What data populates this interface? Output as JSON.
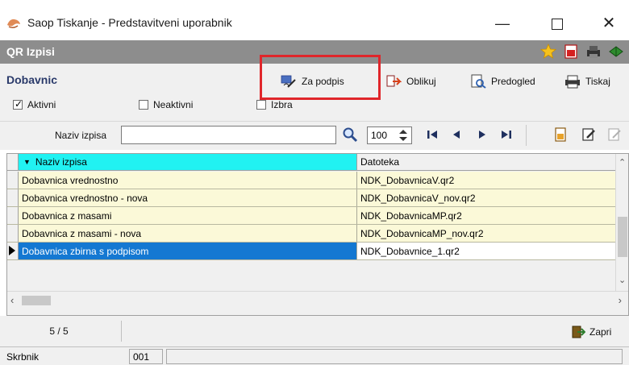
{
  "window": {
    "title": "Saop Tiskanje - Predstavitveni uporabnik",
    "minimize": "—",
    "close": "✕"
  },
  "qrbar": {
    "title": "QR Izpisi"
  },
  "toolbar": {
    "section_title": "Dobavnic",
    "za_podpis": "Za podpis",
    "oblikuj": "Oblikuj",
    "predogled": "Predogled",
    "tiskaj": "Tiskaj"
  },
  "filters": {
    "aktivni": {
      "label": "Aktivni",
      "checked": true
    },
    "neaktivni": {
      "label": "Neaktivni",
      "checked": false
    },
    "izbrani": {
      "label": "Izbra",
      "checked": false
    }
  },
  "search": {
    "label": "Naziv izpisa",
    "value": "",
    "count": "100"
  },
  "grid": {
    "columns": [
      "Naziv izpisa",
      "Datoteka"
    ],
    "rows": [
      {
        "name": "Dobavnica vrednostno",
        "file": "NDK_DobavnicaV.qr2",
        "selected": false
      },
      {
        "name": "Dobavnica vrednostno - nova",
        "file": "NDK_DobavnicaV_nov.qr2",
        "selected": false
      },
      {
        "name": "Dobavnica z masami",
        "file": "NDK_DobavnicaMP.qr2",
        "selected": false
      },
      {
        "name": "Dobavnica z masami - nova",
        "file": "NDK_DobavnicaMP_nov.qr2",
        "selected": false
      },
      {
        "name": "Dobavnica zbirna s podpisom",
        "file": "NDK_Dobavnice_1.qr2",
        "selected": true
      }
    ]
  },
  "footer": {
    "record_count": "5 / 5",
    "close_label": "Zapri"
  },
  "status": {
    "label": "Skrbnik",
    "code": "001"
  },
  "colors": {
    "highlight": "#e0262b",
    "selected_row": "#1478d2",
    "header_active": "#21f2f2",
    "row_bg": "#fbf9d8",
    "qrbar": "#8d8d8d"
  }
}
